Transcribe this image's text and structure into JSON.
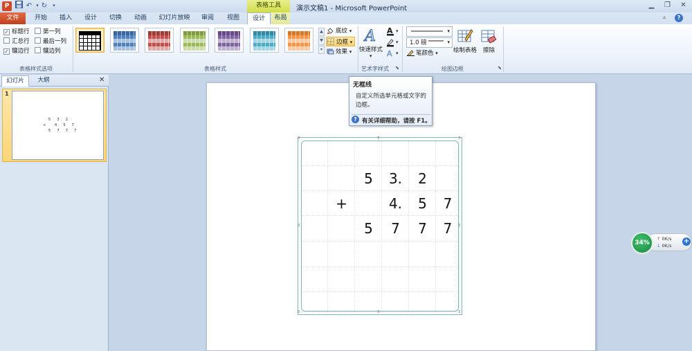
{
  "app": {
    "icon_letter": "P",
    "window_title": "演示文稿1 - Microsoft PowerPoint",
    "context_tab_group": "表格工具"
  },
  "tabs": {
    "file": "文件",
    "home": "开始",
    "insert": "插入",
    "design": "设计",
    "transitions": "切换",
    "animations": "动画",
    "slideshow": "幻灯片放映",
    "review": "审阅",
    "view": "视图",
    "table_design": "设计",
    "table_layout": "布局"
  },
  "ribbon": {
    "options": {
      "header_row": "标题行",
      "first_column": "第一列",
      "total_row": "汇总行",
      "last_column": "最后一列",
      "banded_rows": "镶边行",
      "banded_columns": "镶边列",
      "group_label": "表格样式选项"
    },
    "styles": {
      "group_label": "表格样式",
      "shading": "底纹",
      "border": "边框",
      "effects": "效果",
      "tiles": [
        {
          "color": "#ffffff",
          "header": "#000000",
          "band": "#ffffff"
        },
        {
          "color": "#4f81bd",
          "header": "#3a66a0",
          "band": "#a7c0de"
        },
        {
          "color": "#c0504d",
          "header": "#a03b38",
          "band": "#e0a8a6"
        },
        {
          "color": "#9bbb59",
          "header": "#7d9d3f",
          "band": "#cddcad"
        },
        {
          "color": "#8064a2",
          "header": "#654a87",
          "band": "#c0b2d1"
        },
        {
          "color": "#4bacc6",
          "header": "#308ca6",
          "band": "#a5d5e3"
        },
        {
          "color": "#f79646",
          "header": "#d77826",
          "band": "#fbcaa3"
        }
      ]
    },
    "wordart": {
      "quick_styles": "快速样式",
      "group_label": "艺术字样式"
    },
    "draw_borders": {
      "pen_weight": "1.0 磅",
      "pen_color": "笔颜色",
      "draw_table": "绘制表格",
      "eraser": "擦除",
      "group_label": "绘图边框"
    }
  },
  "left_pane": {
    "tab_slides": "幻灯片",
    "tab_outline": "大纲",
    "close": "✕",
    "slide_number": "1",
    "thumb_lines": [
      "5  3. 2",
      "+   4. 5  7",
      "5  7  7  7"
    ]
  },
  "table": {
    "rows": [
      [
        "",
        "",
        "",
        "",
        "",
        ""
      ],
      [
        "",
        "",
        "5",
        "3.",
        "2",
        ""
      ],
      [
        "",
        "+",
        "",
        "4.",
        "5",
        "7"
      ],
      [
        "",
        "",
        "5",
        "7",
        "7",
        "7"
      ],
      [
        "",
        "",
        "",
        "",
        "",
        ""
      ],
      [
        "",
        "",
        "",
        "",
        "",
        ""
      ],
      [
        "",
        "",
        "",
        "",
        "",
        ""
      ]
    ]
  },
  "tooltip": {
    "title": "无框线",
    "body": "自定义所选单元格或文字的边框。",
    "help": "有关详细帮助，请按 F1。"
  },
  "net_widget": {
    "percent": "34%",
    "up": "0K/s",
    "down": "0K/s"
  }
}
